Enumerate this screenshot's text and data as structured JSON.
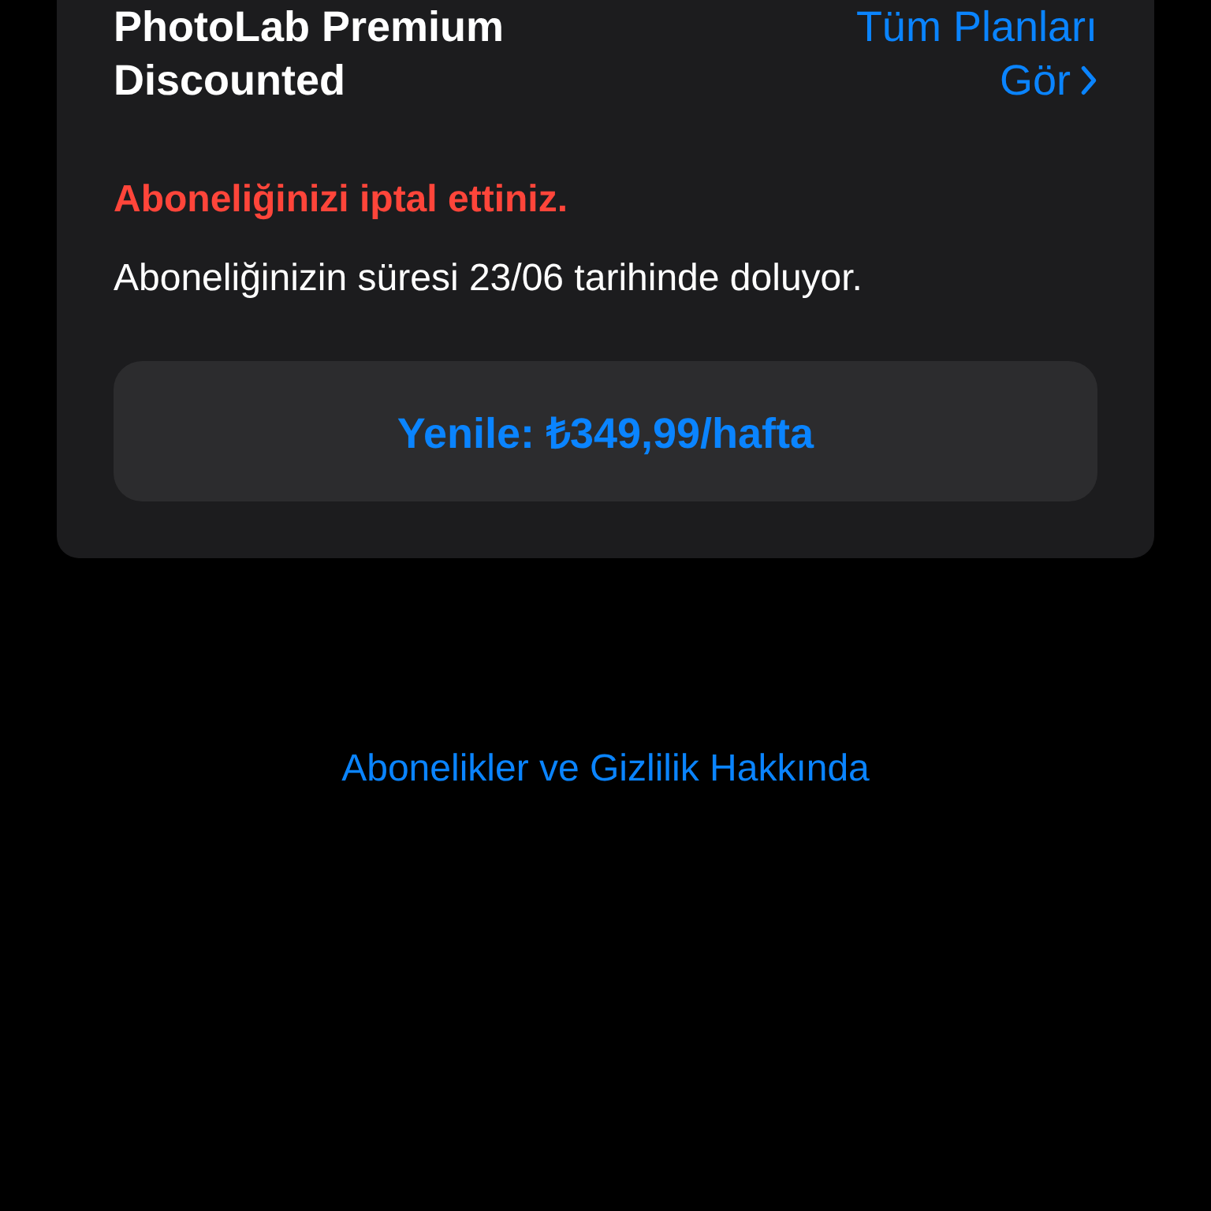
{
  "subscription": {
    "name_lines": [
      "PhotoLab Premium",
      "Discounted"
    ],
    "plans_link_lines": [
      "Tüm Planları",
      "Gör"
    ]
  },
  "status": {
    "cancelled_notice": "Aboneliğinizi iptal ettiniz.",
    "expiry_text": "Aboneliğinizin süresi 23/06 tarihinde doluyor."
  },
  "renew_button": {
    "label": "Yenile: ₺349,99/hafta"
  },
  "footer_link": "Abonelikler ve Gizlilik Hakkında"
}
